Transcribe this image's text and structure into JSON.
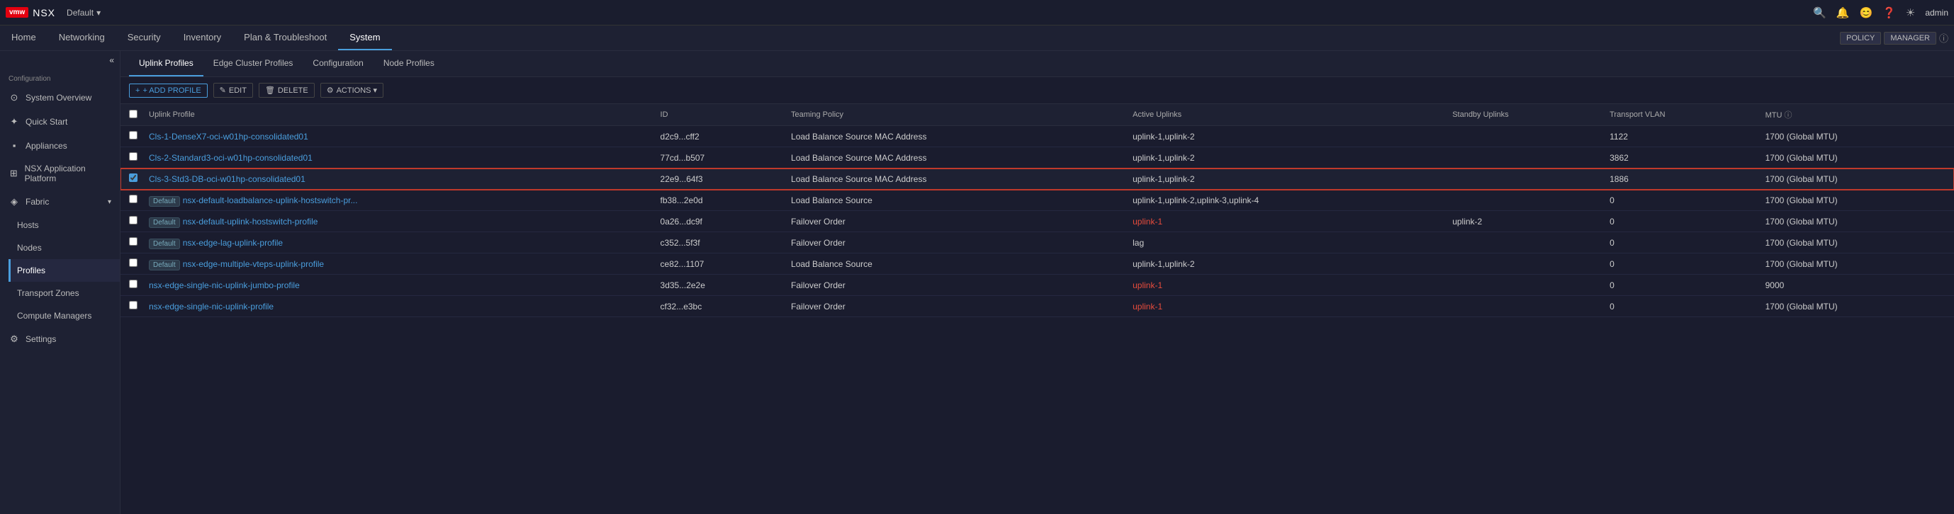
{
  "brand": {
    "vmw_label": "vmw",
    "app_name": "NSX"
  },
  "topbar": {
    "default_label": "Default",
    "chevron": "▾",
    "icons": [
      "search",
      "bell",
      "user-circle",
      "help",
      "sun"
    ],
    "admin_label": "admin"
  },
  "navbar": {
    "items": [
      {
        "label": "Home",
        "active": false
      },
      {
        "label": "Networking",
        "active": false
      },
      {
        "label": "Security",
        "active": false
      },
      {
        "label": "Inventory",
        "active": false
      },
      {
        "label": "Plan & Troubleshoot",
        "active": false
      },
      {
        "label": "System",
        "active": true
      }
    ],
    "policy_btn": "POLICY",
    "manager_btn": "MANAGER",
    "info_icon": "ⓘ"
  },
  "sidebar": {
    "toggle_icon": "«",
    "configuration_label": "Configuration",
    "items": [
      {
        "label": "System Overview",
        "icon": "⊙",
        "active": false
      },
      {
        "label": "Quick Start",
        "icon": "✦",
        "active": false
      },
      {
        "label": "Appliances",
        "icon": "⬛",
        "active": false
      },
      {
        "label": "NSX Application Platform",
        "icon": "⊞",
        "active": false
      },
      {
        "label": "Fabric",
        "icon": "◈",
        "active": false,
        "has_children": true
      },
      {
        "label": "Hosts",
        "icon": "",
        "active": false,
        "indent": true
      },
      {
        "label": "Nodes",
        "icon": "",
        "active": false,
        "indent": true
      },
      {
        "label": "Profiles",
        "icon": "",
        "active": true,
        "indent": true
      },
      {
        "label": "Transport Zones",
        "icon": "",
        "active": false,
        "indent": true
      },
      {
        "label": "Compute Managers",
        "icon": "",
        "active": false,
        "indent": true
      }
    ],
    "settings_label": "Settings"
  },
  "content": {
    "tabs": [
      {
        "label": "Uplink Profiles",
        "active": true
      },
      {
        "label": "Edge Cluster Profiles",
        "active": false
      },
      {
        "label": "Configuration",
        "active": false
      },
      {
        "label": "Node Profiles",
        "active": false
      }
    ],
    "toolbar": {
      "add_label": "+ ADD PROFILE",
      "edit_label": "✎ EDIT",
      "delete_label": "🗑 DELETE",
      "actions_label": "⚙ ACTIONS ▾"
    },
    "table": {
      "columns": [
        "Uplink Profile",
        "ID",
        "Teaming Policy",
        "Active Uplinks",
        "Standby Uplinks",
        "Transport VLAN",
        "MTU"
      ],
      "rows": [
        {
          "name": "Cls-1-DenseX7-oci-w01hp-consolidated01",
          "id": "d2c9...cff2",
          "teaming_policy": "Load Balance Source MAC Address",
          "active_uplinks": "uplink-1,uplink-2",
          "standby_uplinks": "",
          "transport_vlan": "1122",
          "mtu": "1700 (Global MTU)",
          "is_default": false,
          "selected": false,
          "highlighted": false
        },
        {
          "name": "Cls-2-Standard3-oci-w01hp-consolidated01",
          "id": "77cd...b507",
          "teaming_policy": "Load Balance Source MAC Address",
          "active_uplinks": "uplink-1,uplink-2",
          "standby_uplinks": "",
          "transport_vlan": "3862",
          "mtu": "1700 (Global MTU)",
          "is_default": false,
          "selected": false,
          "highlighted": false
        },
        {
          "name": "Cls-3-Std3-DB-oci-w01hp-consolidated01",
          "id": "22e9...64f3",
          "teaming_policy": "Load Balance Source MAC Address",
          "active_uplinks": "uplink-1,uplink-2",
          "standby_uplinks": "",
          "transport_vlan": "1886",
          "mtu": "1700 (Global MTU)",
          "is_default": false,
          "selected": true,
          "highlighted": true
        },
        {
          "name": "nsx-default-loadbalance-uplink-hostswitch-pr...",
          "id": "fb38...2e0d",
          "teaming_policy": "Load Balance Source",
          "active_uplinks": "uplink-1,uplink-2,uplink-3,uplink-4",
          "standby_uplinks": "",
          "transport_vlan": "0",
          "mtu": "1700 (Global MTU)",
          "is_default": true,
          "selected": false,
          "highlighted": false
        },
        {
          "name": "nsx-default-uplink-hostswitch-profile",
          "id": "0a26...dc9f",
          "teaming_policy": "Failover Order",
          "active_uplinks": "uplink-1",
          "standby_uplinks": "uplink-2",
          "transport_vlan": "0",
          "mtu": "1700 (Global MTU)",
          "is_default": true,
          "selected": false,
          "highlighted": false,
          "active_uplinks_red": true
        },
        {
          "name": "nsx-edge-lag-uplink-profile",
          "id": "c352...5f3f",
          "teaming_policy": "Failover Order",
          "active_uplinks": "lag",
          "standby_uplinks": "",
          "transport_vlan": "0",
          "mtu": "1700 (Global MTU)",
          "is_default": true,
          "selected": false,
          "highlighted": false
        },
        {
          "name": "nsx-edge-multiple-vteps-uplink-profile",
          "id": "ce82...1107",
          "teaming_policy": "Load Balance Source",
          "active_uplinks": "uplink-1,uplink-2",
          "standby_uplinks": "",
          "transport_vlan": "0",
          "mtu": "1700 (Global MTU)",
          "is_default": true,
          "selected": false,
          "highlighted": false
        },
        {
          "name": "nsx-edge-single-nic-uplink-jumbo-profile",
          "id": "3d35...2e2e",
          "teaming_policy": "Failover Order",
          "active_uplinks": "uplink-1",
          "standby_uplinks": "",
          "transport_vlan": "0",
          "mtu": "9000",
          "is_default": false,
          "selected": false,
          "highlighted": false,
          "active_uplinks_red": true
        },
        {
          "name": "nsx-edge-single-nic-uplink-profile",
          "id": "cf32...e3bc",
          "teaming_policy": "Failover Order",
          "active_uplinks": "uplink-1",
          "standby_uplinks": "",
          "transport_vlan": "0",
          "mtu": "1700 (Global MTU)",
          "is_default": false,
          "selected": false,
          "highlighted": false,
          "active_uplinks_red": true
        }
      ]
    }
  }
}
